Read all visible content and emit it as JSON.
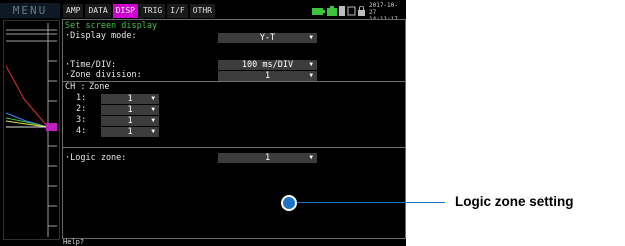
{
  "menu_label": "MENU",
  "tabs": [
    {
      "label": "AMP",
      "active": false
    },
    {
      "label": "DATA",
      "active": false
    },
    {
      "label": "DISP",
      "active": true
    },
    {
      "label": "TRIG",
      "active": false
    },
    {
      "label": "I/F",
      "active": false
    },
    {
      "label": "OTHR",
      "active": false
    }
  ],
  "datetime": {
    "date": "2017-10-27",
    "time": "14:11:17"
  },
  "colors": {
    "accent_tab": "#d000d0",
    "title_green": "#44c044",
    "callout_blue": "#1e73c8"
  },
  "status_icons": [
    "battery-icon",
    "ac-power-icon",
    "memory-card-icon",
    "usb-icon",
    "lock-icon"
  ],
  "screen": {
    "title": "Set screen display",
    "display_mode": {
      "label": "·Display mode:",
      "value": "Y-T"
    },
    "time_div": {
      "label": "·Time/DIV:",
      "value": "100 ms/DIV"
    },
    "zone_division": {
      "label": "·Zone division:",
      "value": "1"
    },
    "zone_header": {
      "ch": "CH :",
      "zone": "Zone"
    },
    "channels": [
      {
        "label": "1:",
        "value": "1"
      },
      {
        "label": "2:",
        "value": "1"
      },
      {
        "label": "3:",
        "value": "1"
      },
      {
        "label": "4:",
        "value": "1"
      }
    ],
    "logic_zone": {
      "label": "·Logic zone:",
      "value": "1"
    }
  },
  "help": "Help?",
  "callout": {
    "label": "Logic zone setting"
  }
}
